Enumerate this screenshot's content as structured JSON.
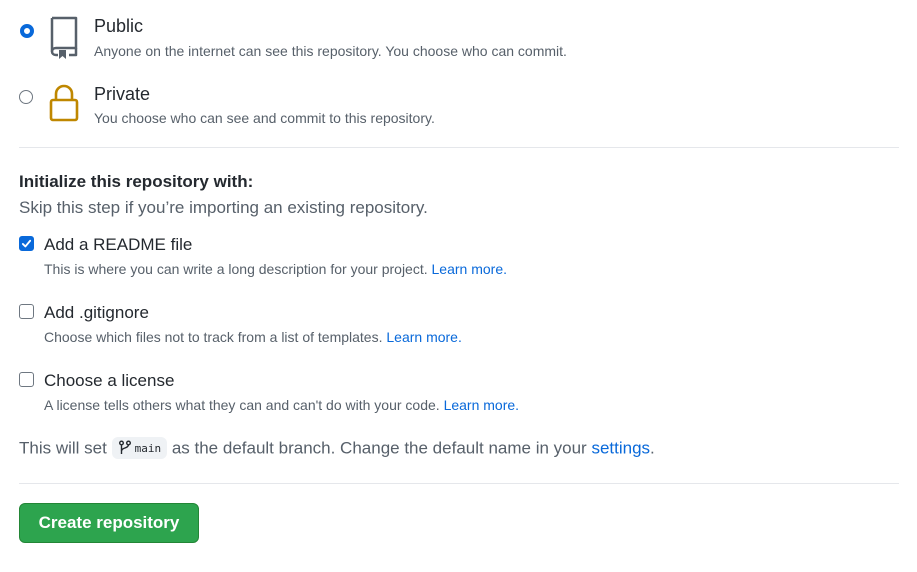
{
  "visibility": {
    "public": {
      "title": "Public",
      "description": "Anyone on the internet can see this repository. You choose who can commit.",
      "selected": true,
      "icon": "repo-icon"
    },
    "private": {
      "title": "Private",
      "description": "You choose who can see and commit to this repository.",
      "selected": false,
      "icon": "lock-icon",
      "icon_color": "#bf8700"
    }
  },
  "init": {
    "heading": "Initialize this repository with:",
    "subheading": "Skip this step if you’re importing an existing repository.",
    "options": [
      {
        "label": "Add a README file",
        "description": "This is where you can write a long description for your project.",
        "link": "Learn more.",
        "checked": true
      },
      {
        "label": "Add .gitignore",
        "description": "Choose which files not to track from a list of templates.",
        "link": "Learn more.",
        "checked": false
      },
      {
        "label": "Choose a license",
        "description": "A license tells others what they can and can't do with your code.",
        "link": "Learn more.",
        "checked": false
      }
    ]
  },
  "branch": {
    "prefix": "This will set",
    "name": "main",
    "middle": "as the default branch. Change the default name in your",
    "link": "settings",
    "suffix": "."
  },
  "create_button": "Create repository",
  "colors": {
    "accent": "#0969da",
    "primary_button": "#2da44e",
    "lock": "#bf8700"
  }
}
